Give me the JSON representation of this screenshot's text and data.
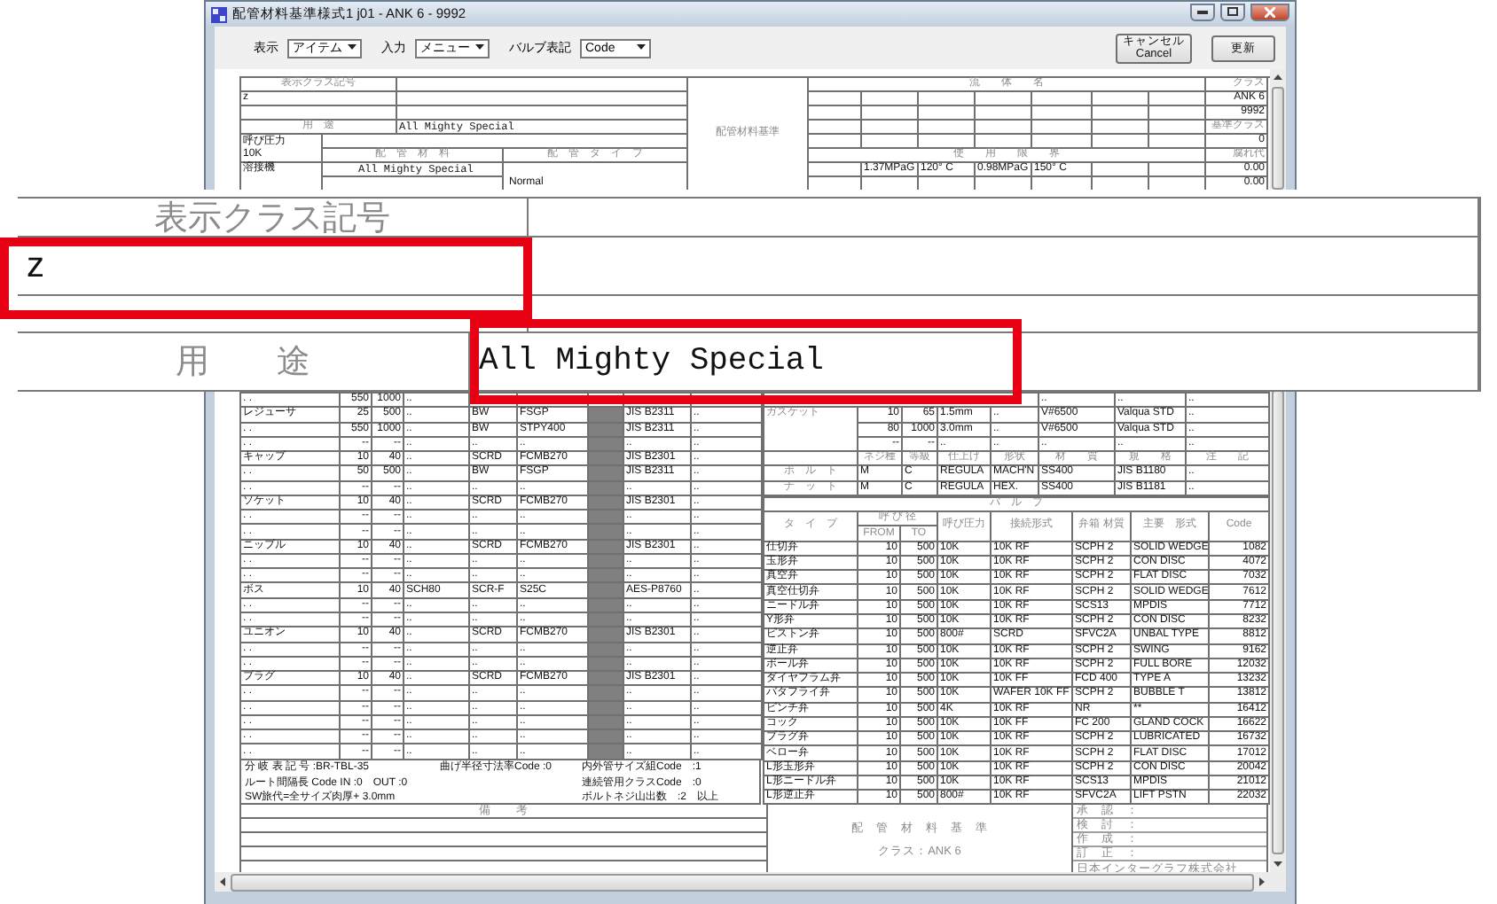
{
  "window": {
    "title": "配管材料基準様式1 j01 - ANK 6 - 9992"
  },
  "toolbar": {
    "selects": [
      {
        "label": "表示",
        "value": "アイテム"
      },
      {
        "label": "入力",
        "value": "メニュー"
      },
      {
        "label": "バルブ表記",
        "value": "Code"
      }
    ],
    "cancel_button": [
      "キャンセル",
      "Cancel"
    ],
    "update_button": "更新"
  },
  "class_sheet": {
    "class_label": "表示クラス記号",
    "class_value": "z",
    "usage_label": "用　途",
    "usage_value": "All Mighty Special",
    "pressure_label": "呼び圧力",
    "pressure_value": "10K",
    "material_header": "配　管　材　料",
    "type_header": "配　管　タ　イ　プ",
    "weld_label": "溶接機",
    "weld_material": "All Mighty Special",
    "pipe_type": "Normal",
    "center_title": "配管材料基準",
    "fluid_header": "流　　体　　名",
    "class_header": "クラス",
    "class_values": [
      "ANK 6",
      "9992",
      "基準クラス",
      "0"
    ],
    "limit_header": "使　　用　　限　　界",
    "corrosion_header": "腐れ代",
    "limits": [
      "1.37MPaG",
      "120° C",
      "0.98MPaG",
      "150° C"
    ],
    "corrosion": [
      "0.00",
      "0.00"
    ]
  },
  "magnifier": {
    "class_label": "表示クラス記号",
    "class_value": "z",
    "usage_label": "用　　途",
    "usage_value": "All Mighty Special"
  },
  "fittings": [
    [
      ". .",
      "550",
      "1000",
      ".."
    ],
    [
      "レジューサ",
      "25",
      "500",
      "..",
      "BW",
      "FSGP",
      "JIS B2311",
      ".."
    ],
    [
      ". .",
      "550",
      "1000",
      "..",
      "BW",
      "STPY400",
      "JIS B2311",
      ".."
    ],
    [
      ". .",
      "--",
      "--",
      "..",
      "..",
      "..",
      "..",
      ".."
    ],
    [
      "キャップ",
      "10",
      "40",
      "..",
      "SCRD",
      "FCMB270",
      "JIS B2301",
      ".."
    ],
    [
      ". .",
      "50",
      "500",
      "..",
      "BW",
      "FSGP",
      "JIS B2311",
      ".."
    ],
    [
      ". .",
      "--",
      "--",
      "..",
      "..",
      "..",
      "..",
      ".."
    ],
    [
      "ソケット",
      "10",
      "40",
      "..",
      "SCRD",
      "FCMB270",
      "JIS B2301",
      ".."
    ],
    [
      ". .",
      "--",
      "--",
      "..",
      "..",
      "..",
      "..",
      ".."
    ],
    [
      ". .",
      "--",
      "--",
      "..",
      "..",
      "..",
      "..",
      ".."
    ],
    [
      "ニップル",
      "10",
      "40",
      "..",
      "SCRD",
      "FCMB270",
      "JIS B2301",
      ".."
    ],
    [
      ". .",
      "--",
      "--",
      "..",
      "..",
      "..",
      "..",
      ".."
    ],
    [
      ". .",
      "--",
      "--",
      "..",
      "..",
      "..",
      "..",
      ".."
    ],
    [
      "ボス",
      "10",
      "40",
      "SCH80",
      "SCR-F",
      "S25C",
      "AES-P8760",
      ".."
    ],
    [
      ". .",
      "--",
      "--",
      "..",
      "..",
      "..",
      "..",
      ".."
    ],
    [
      ". .",
      "--",
      "--",
      "..",
      "..",
      "..",
      "..",
      ".."
    ],
    [
      "ユニオン",
      "10",
      "40",
      "..",
      "SCRD",
      "FCMB270",
      "JIS B2301",
      ".."
    ],
    [
      ". .",
      "--",
      "--",
      "..",
      "..",
      "..",
      "..",
      ".."
    ],
    [
      ". .",
      "--",
      "--",
      "..",
      "..",
      "..",
      "..",
      ".."
    ],
    [
      "プラグ",
      "10",
      "40",
      "..",
      "SCRD",
      "FCMB270",
      "JIS B2301",
      ".."
    ],
    [
      ". .",
      "--",
      "--",
      "..",
      "..",
      "..",
      "..",
      ".."
    ],
    [
      ". .",
      "--",
      "--",
      "..",
      "..",
      "..",
      "..",
      ".."
    ],
    [
      ". .",
      "--",
      "--",
      "..",
      "..",
      "..",
      "..",
      ".."
    ],
    [
      ". .",
      "--",
      "--",
      "..",
      "..",
      "..",
      "..",
      ".."
    ],
    [
      ". .",
      "--",
      "--",
      "..",
      "..",
      "..",
      "..",
      ".."
    ]
  ],
  "notes": [
    {
      "left": "分 岐 表 記 号 :BR-TBL-35",
      "middle": "曲げ半径寸法率Code :0",
      "right": "内外管サイズ組Code　:1"
    },
    {
      "left": "ルート間隔長 Code IN :0　OUT :0",
      "right": "連続管用クラスCode　:0"
    },
    {
      "left": "SW旅代=全サイズ肉厚+ 3.0mm",
      "right": "ボルトネジ山出数　:2　以上"
    }
  ],
  "gaskets": {
    "label": "ガスケット",
    "top_row": [
      "..",
      "..",
      ".."
    ],
    "rows": [
      [
        "10",
        "65",
        "1.5mm",
        "..",
        "V#6500",
        "Valqua STD",
        ".."
      ],
      [
        "80",
        "1000",
        "3.0mm",
        "..",
        "V#6500",
        "Valqua STD",
        ".."
      ],
      [
        "--",
        "--",
        "..",
        "..",
        "..",
        "..",
        ".."
      ]
    ]
  },
  "bolts": {
    "header": [
      "ネジ種",
      "等級",
      "仕上げ",
      "形状",
      "材　　質",
      "規　　格",
      "注　　記"
    ],
    "rows": [
      {
        "name": "ボ　ル　ト",
        "cells": [
          "M",
          "C",
          "REGULA",
          "MACH'N",
          "SS400",
          "JIS B1180",
          ".."
        ]
      },
      {
        "name": "ナ　ッ　ト",
        "cells": [
          "M",
          "C",
          "REGULA",
          "HEX.",
          "SS400",
          "JIS B1181",
          ".."
        ]
      }
    ]
  },
  "valves": {
    "title": "バ　ル　ブ",
    "header": {
      "type": "タ　イ　プ",
      "size": "呼 び 径",
      "from": "FROM",
      "to": "TO",
      "pressure": "呼び圧力",
      "connection": "接続形式",
      "body": "弁箱 材質",
      "style": "主要　形式",
      "code": "Code"
    },
    "rows": [
      [
        "仕切弁",
        "10",
        "500",
        "10K",
        "10K RF",
        "SCPH 2",
        "SOLID WEDGE",
        "1082"
      ],
      [
        "玉形弁",
        "10",
        "500",
        "10K",
        "10K RF",
        "SCPH 2",
        "CON DISC",
        "4072"
      ],
      [
        "真空弁",
        "10",
        "500",
        "10K",
        "10K RF",
        "SCPH 2",
        "FLAT DISC",
        "7032"
      ],
      [
        "真空仕切弁",
        "10",
        "500",
        "10K",
        "10K RF",
        "SCPH 2",
        "SOLID WEDGE",
        "7612"
      ],
      [
        "ニードル弁",
        "10",
        "500",
        "10K",
        "10K RF",
        "SCS13",
        "MPDIS",
        "7712"
      ],
      [
        "Y形弁",
        "10",
        "500",
        "10K",
        "10K RF",
        "SCPH 2",
        "CON DISC",
        "8232"
      ],
      [
        "ピストン弁",
        "10",
        "500",
        "800#",
        "SCRD",
        "SFVC2A",
        "UNBAL TYPE",
        "8812"
      ],
      [
        "逆止弁",
        "10",
        "500",
        "10K",
        "10K RF",
        "SCPH 2",
        "SWING",
        "9162"
      ],
      [
        "ボール弁",
        "10",
        "500",
        "10K",
        "10K RF",
        "SCPH 2",
        "FULL BORE",
        "12032"
      ],
      [
        "ダイヤフラム弁",
        "10",
        "500",
        "10K",
        "10K FF",
        "FCD 400",
        "TYPE A",
        "13232"
      ],
      [
        "バタフライ弁",
        "10",
        "500",
        "10K",
        "WAFER 10K FF",
        "SCPH 2",
        "BUBBLE T",
        "13812"
      ],
      [
        "ピンチ弁",
        "10",
        "500",
        "4K",
        "10K RF",
        "NR",
        "**",
        "16412"
      ],
      [
        "コック",
        "10",
        "500",
        "10K",
        "10K FF",
        "FC 200",
        "GLAND COCK",
        "16622"
      ],
      [
        "プラグ弁",
        "10",
        "500",
        "10K",
        "10K RF",
        "SCPH 2",
        "LUBRICATED",
        "16732"
      ],
      [
        "ベロー弁",
        "10",
        "500",
        "10K",
        "10K RF",
        "SCPH 2",
        "FLAT DISC",
        "17012"
      ],
      [
        "L形玉形弁",
        "10",
        "500",
        "10K",
        "10K RF",
        "SCPH 2",
        "CON DISC",
        "20042"
      ],
      [
        "L形ニードル弁",
        "10",
        "500",
        "10K",
        "10K RF",
        "SCS13",
        "MPDIS",
        "21012"
      ],
      [
        "L形逆止弁",
        "10",
        "500",
        "800#",
        "10K RF",
        "SFVC2A",
        "LIFT PSTN",
        "22032"
      ]
    ]
  },
  "remarks": {
    "title": "備　　考"
  },
  "stamp": {
    "title": "配　管　材　料　基　準",
    "class": "クラス：ANK 6"
  },
  "approvals": [
    "承　認　：",
    "検　討　：",
    "作　成　：",
    "訂　正　："
  ],
  "company": "日本インターグラフ株式会社"
}
